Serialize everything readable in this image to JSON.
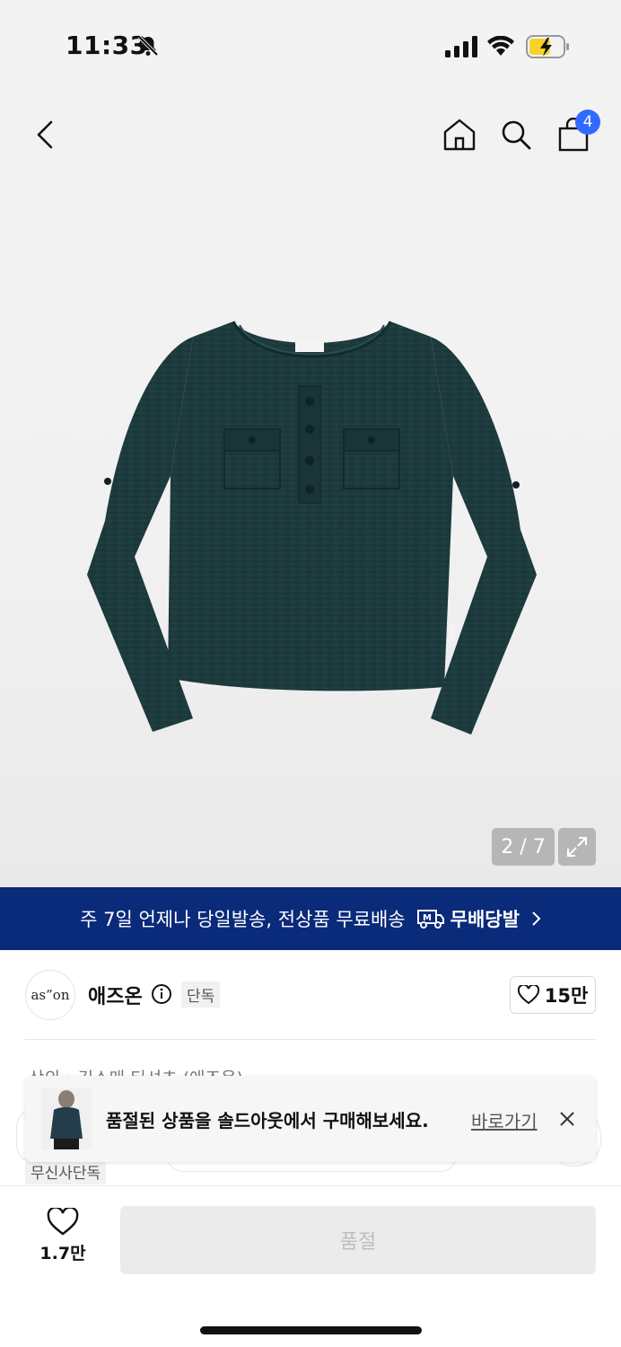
{
  "status_bar": {
    "time": "11:33"
  },
  "nav": {
    "cart_count": "4"
  },
  "gallery": {
    "counter": "2 / 7"
  },
  "delivery_banner": {
    "text": "주 7일 언제나 당일발송, 전상품 무료배송",
    "brand_badge": "M",
    "brand_label": "무배당발"
  },
  "brand": {
    "logo_text": "as”on",
    "name": "애즈온",
    "tag": "단독",
    "likes": "15만"
  },
  "breadcrumb": "상의 › 긴소매 티셔츠 (애즈온)",
  "tags": {
    "musinsa": "무신사단독"
  },
  "toast": {
    "message": "품절된 상품을 솔드아웃에서 구매해보세요.",
    "link_label": "바로가기"
  },
  "bottom_bar": {
    "wish_count": "1.7만",
    "buy_label": "품절"
  },
  "colors": {
    "banner_bg": "#0a2a7a",
    "badge_blue": "#2f6bff",
    "product_green": "#1d3a3c",
    "battery_yellow": "#f5d327"
  }
}
